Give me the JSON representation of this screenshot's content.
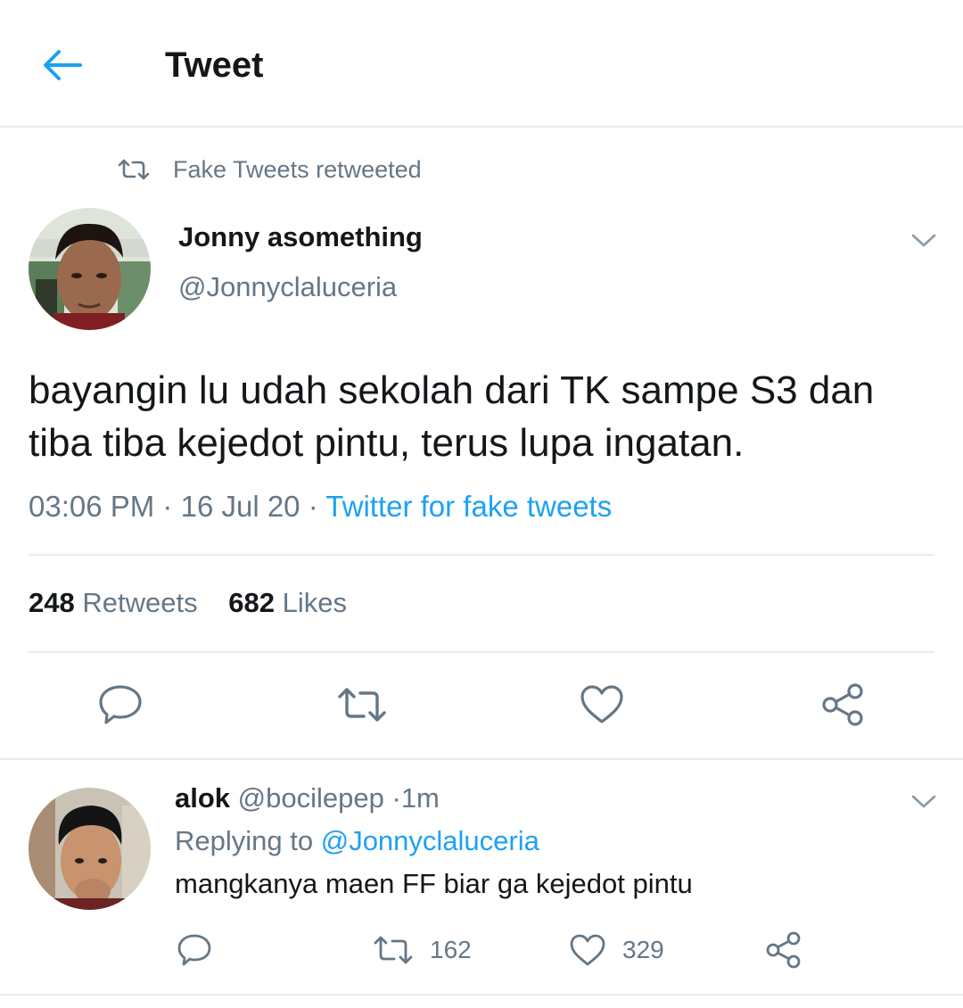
{
  "header": {
    "title": "Tweet",
    "back_icon": "arrow-left-icon"
  },
  "retweet_context": {
    "label": "Fake Tweets retweeted",
    "icon": "retweet-icon"
  },
  "tweet": {
    "author_name": "Jonny asomething",
    "author_handle": "@Jonnyclaluceria",
    "text": "bayangin lu udah sekolah dari TK sampe S3 dan tiba tiba kejedot pintu, terus lupa ingatan.",
    "time": "03:06 PM",
    "separator": "·",
    "date": "16 Jul 20",
    "source": "Twitter for fake tweets",
    "retweets_count": "248",
    "retweets_label": "Retweets",
    "likes_count": "682",
    "likes_label": "Likes",
    "actions": [
      "reply-icon",
      "retweet-icon",
      "heart-icon",
      "share-icon"
    ]
  },
  "reply": {
    "author_name": "alok",
    "author_handle": "@bocilepep",
    "separator": "·",
    "age": "1m",
    "replying_prefix": "Replying to",
    "replying_to": "@Jonnyclaluceria",
    "text": "mangkanya maen FF biar ga kejedot pintu",
    "retweets_count": "162",
    "likes_count": "329"
  },
  "colors": {
    "accent": "#1da1f2",
    "text_primary": "#14171a",
    "text_secondary": "#657786",
    "divider": "#e6ecf0"
  }
}
